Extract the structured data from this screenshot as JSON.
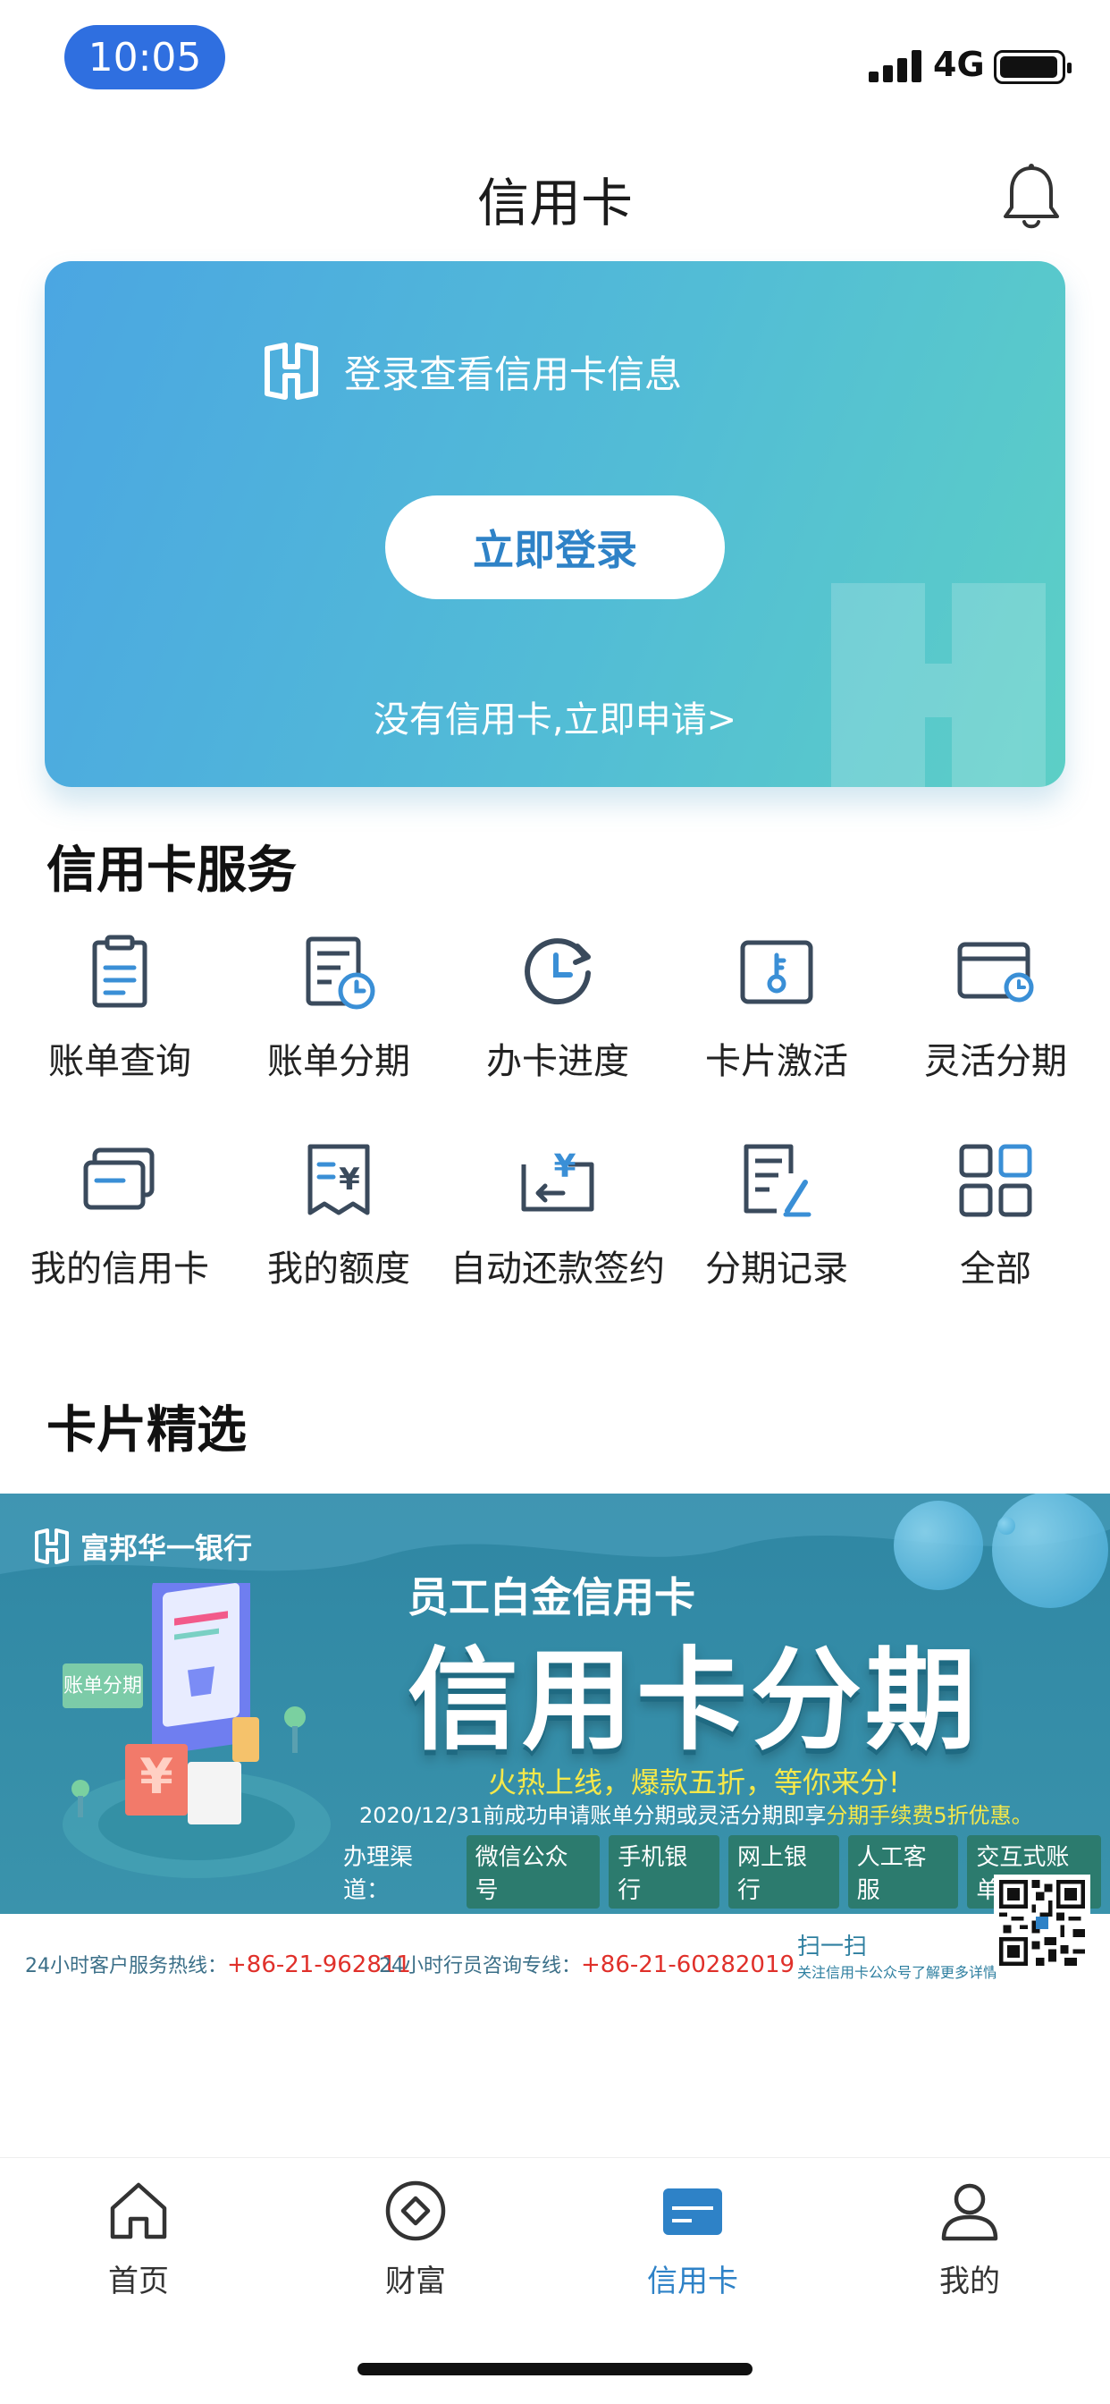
{
  "status_bar": {
    "time": "10:05",
    "network": "4G"
  },
  "header": {
    "title": "信用卡"
  },
  "login_card": {
    "hint": "登录查看信用卡信息",
    "login_button": "立即登录",
    "apply_link": "没有信用卡,立即申请>"
  },
  "services": {
    "title": "信用卡服务",
    "items": [
      {
        "label": "账单查询",
        "icon": "clipboard-icon"
      },
      {
        "label": "账单分期",
        "icon": "bill-clock-icon"
      },
      {
        "label": "办卡进度",
        "icon": "progress-clock-icon"
      },
      {
        "label": "卡片激活",
        "icon": "card-key-icon"
      },
      {
        "label": "灵活分期",
        "icon": "card-clock-icon"
      },
      {
        "label": "我的信用卡",
        "icon": "cards-icon"
      },
      {
        "label": "我的额度",
        "icon": "receipt-yen-icon"
      },
      {
        "label": "自动还款签约",
        "icon": "auto-repay-icon"
      },
      {
        "label": "分期记录",
        "icon": "record-edit-icon"
      },
      {
        "label": "全部",
        "icon": "grid-icon"
      }
    ]
  },
  "featured": {
    "title": "卡片精选",
    "banner": {
      "bank_name": "富邦华一银行",
      "sub_title": "员工白金信用卡",
      "main_title": "信用卡分期",
      "slogan": "火热上线，爆款五折，等你来分!",
      "desc_prefix": "2020/12/31前成功申请账单分期或灵活分期即享",
      "desc_highlight": "分期手续费5折优惠。",
      "channels_label": "办理渠道：",
      "channels": [
        "微信公众号",
        "手机银行",
        "网上银行",
        "人工客服",
        "交互式账单"
      ],
      "hotline_label": "24小时客户服务热线：",
      "hotline_number": "+86-21-962811",
      "consult_label": "24小时行员咨询专线：",
      "consult_number": "+86-21-60282019",
      "scan_label": "扫一扫",
      "scan_sub": "关注信用卡公众号了解更多详情",
      "illustration_tag": "账单分期"
    }
  },
  "tab_bar": {
    "items": [
      {
        "label": "首页",
        "icon": "home-icon",
        "active": false
      },
      {
        "label": "财富",
        "icon": "wealth-icon",
        "active": false
      },
      {
        "label": "信用卡",
        "icon": "credit-card-icon",
        "active": true
      },
      {
        "label": "我的",
        "icon": "profile-icon",
        "active": false
      }
    ]
  },
  "colors": {
    "accent": "#2e82c7",
    "card_gradient_start": "#4ba6e2",
    "card_gradient_end": "#5ccfc6",
    "banner_bg": "#3a8ea8",
    "highlight_yellow": "#f5e84a",
    "hotline_red": "#e0302a"
  }
}
